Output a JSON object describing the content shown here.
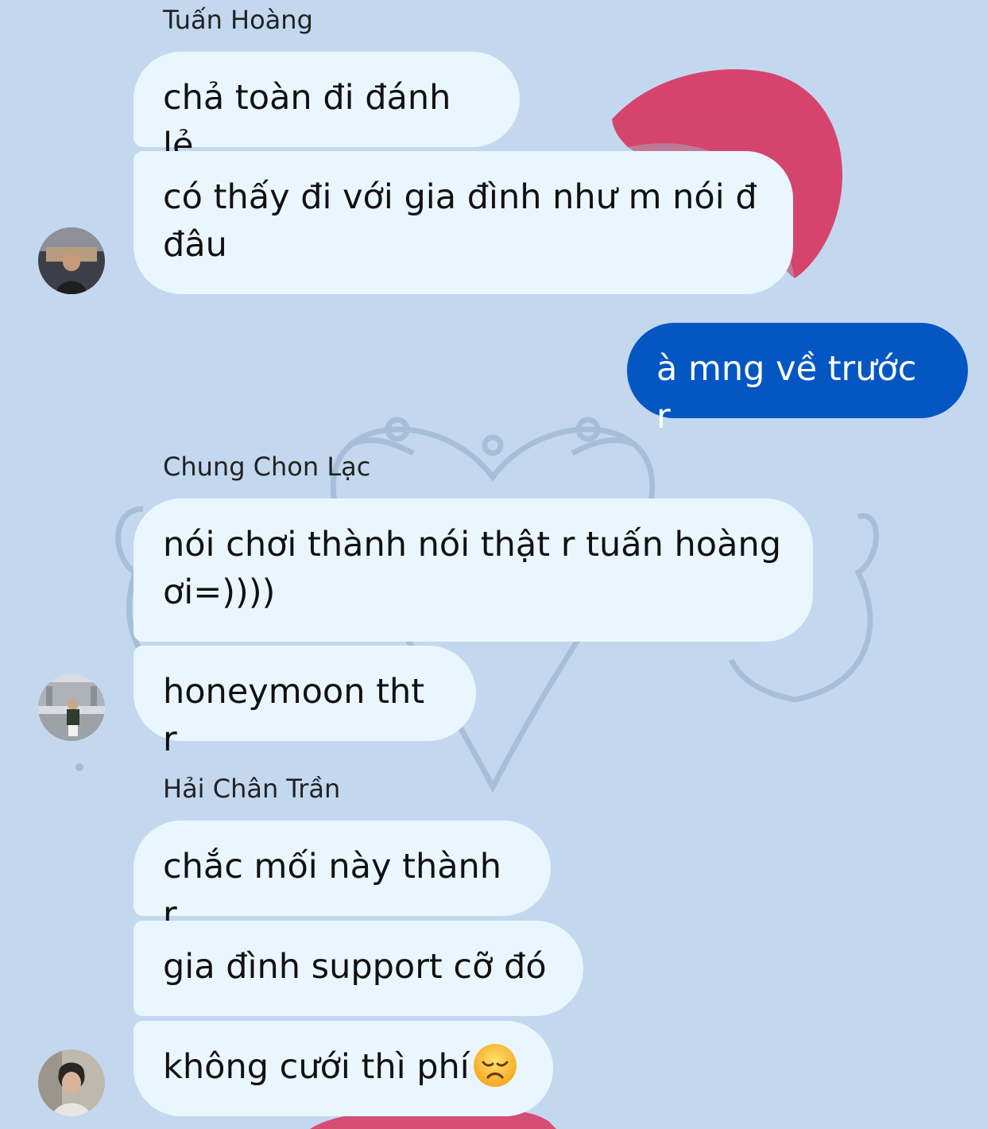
{
  "chat": {
    "groups": [
      {
        "sender": "Tuấn Hoàng",
        "messages": [
          "chả toàn đi đánh lẻ",
          "có thấy đi với gia đình như m nói đ đâu"
        ]
      },
      {
        "sender": "",
        "outgoing": true,
        "messages": [
          "à mng về trước r"
        ]
      },
      {
        "sender": "Chung Chon Lạc",
        "messages": [
          "nói chơi thành nói thật r tuấn hoàng ơi=))))",
          "honeymoon tht r"
        ]
      },
      {
        "sender": "Hải Chân Trần",
        "messages": [
          "chắc mối này thành r",
          "gia đình support cỡ đó",
          "không cưới thì phí"
        ]
      }
    ],
    "emoji_last_message": "disappointed-face-emoji"
  },
  "colors": {
    "background": "#c3d8ef",
    "incoming_bubble": "#eaf6fd",
    "outgoing_bubble": "#0457c3",
    "outgoing_text": "#ffffff",
    "lipstick": "#d8345f"
  }
}
